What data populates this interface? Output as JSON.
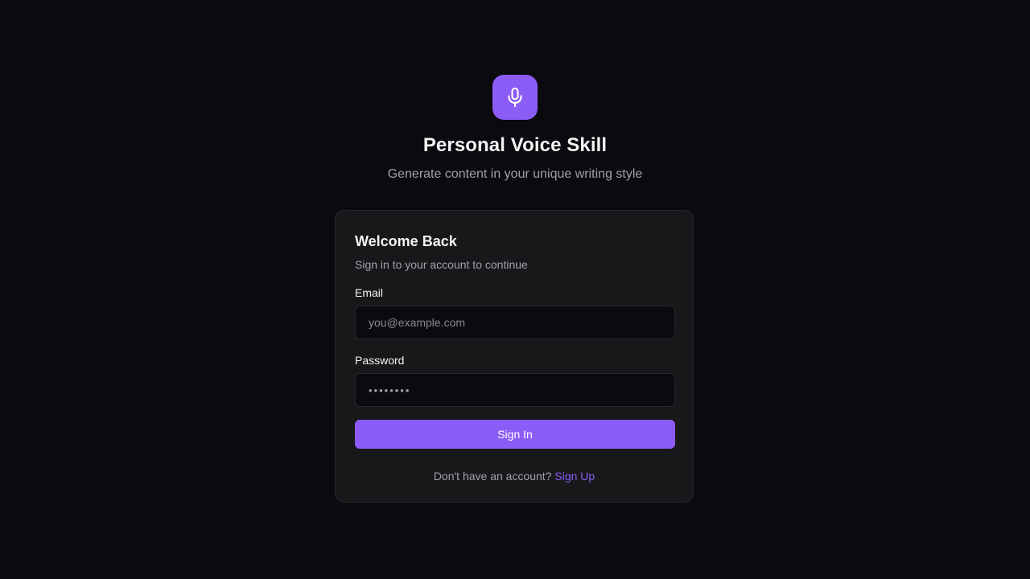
{
  "brand": {
    "icon": "microphone-icon",
    "accent_color": "#8b5cf6",
    "title": "Personal Voice Skill",
    "subtitle": "Generate content in your unique writing style"
  },
  "login_card": {
    "title": "Welcome Back",
    "subtitle": "Sign in to your account to continue",
    "email": {
      "label": "Email",
      "placeholder": "you@example.com",
      "value": ""
    },
    "password": {
      "label": "Password",
      "value": "••••••••"
    },
    "submit_label": "Sign In",
    "signup_prompt": "Don't have an account?",
    "signup_link": "Sign Up"
  }
}
